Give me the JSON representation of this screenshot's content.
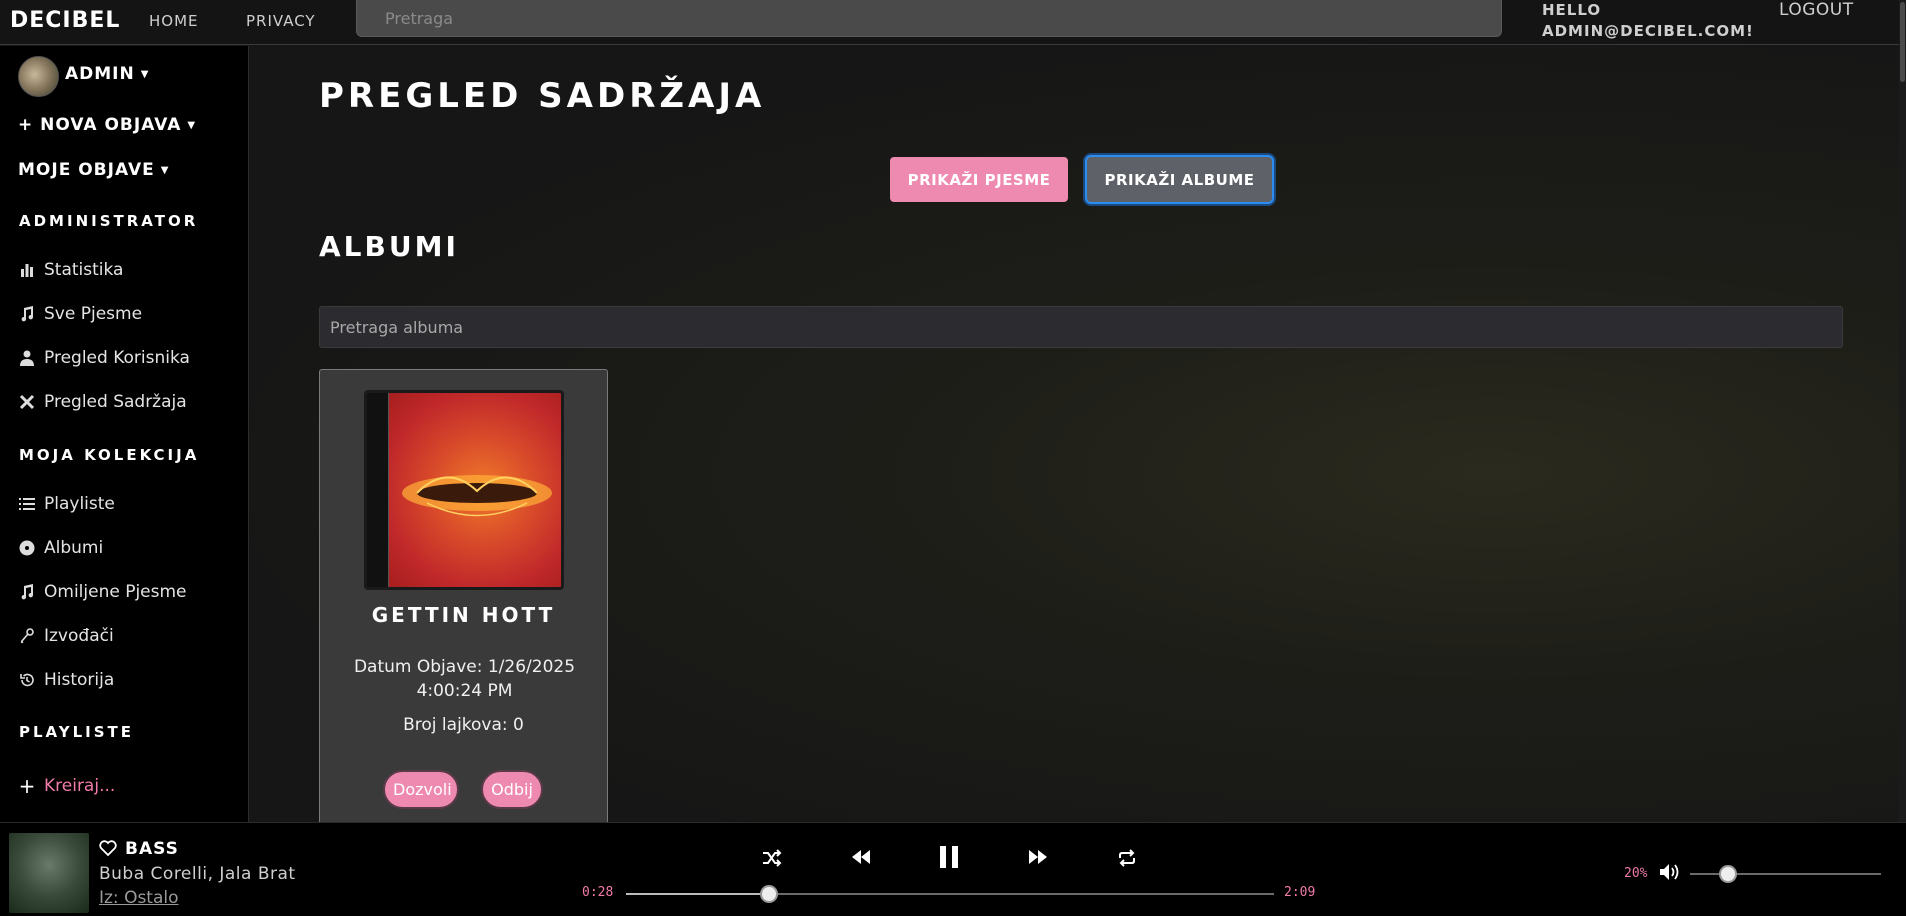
{
  "navbar": {
    "brand": "DECIBEL",
    "links": [
      "HOME",
      "PRIVACY"
    ],
    "search_placeholder": "Pretraga",
    "hello_line1": "HELLO",
    "hello_line2": "ADMIN@DECIBEL.COM!",
    "logout": "LOGOUT"
  },
  "sidebar": {
    "user": "ADMIN",
    "new_post": "+ NOVA OBJAVA",
    "my_posts": "MOJE OBJAVE",
    "admin_heading": "ADMINISTRATOR",
    "admin_items": [
      {
        "label": "Statistika",
        "icon": "chart-icon"
      },
      {
        "label": "Sve Pjesme",
        "icon": "music-note-icon"
      },
      {
        "label": "Pregled Korisnika",
        "icon": "user-icon"
      },
      {
        "label": "Pregled Sadržaja",
        "icon": "tools-icon"
      }
    ],
    "collection_heading": "MOJA KOLEKCIJA",
    "collection_items": [
      {
        "label": "Playliste",
        "icon": "list-icon"
      },
      {
        "label": "Albumi",
        "icon": "disc-icon"
      },
      {
        "label": "Omiljene Pjesme",
        "icon": "music-note-icon"
      },
      {
        "label": "Izvođači",
        "icon": "microphone-icon"
      },
      {
        "label": "Historija",
        "icon": "history-icon"
      }
    ],
    "playlists_heading": "PLAYLISTE",
    "create": "Kreiraj..."
  },
  "main": {
    "title": "PREGLED SADRŽAJA",
    "show_songs": "PRIKAŽI PJESME",
    "show_albums": "PRIKAŽI ALBUME",
    "section_title": "ALBUMI",
    "album_search_placeholder": "Pretraga albuma",
    "albums": [
      {
        "title": "GETTIN HOTT",
        "date_label": "Datum Objave:",
        "date_value": "1/26/2025 4:00:24 PM",
        "likes": "Broj lajkova: 0",
        "approve": "Dozvoli",
        "reject": "Odbij"
      }
    ]
  },
  "player": {
    "title": "BASS",
    "artist": "Buba Corelli, Jala Brat",
    "from": "Iz: Ostalo",
    "current_time": "0:28",
    "total_time": "2:09",
    "progress": 0.22,
    "volume": "20%",
    "volume_level": 0.2
  },
  "colors": {
    "accent_pink": "#ee8ab0",
    "focus_blue": "#2d8cf0"
  }
}
